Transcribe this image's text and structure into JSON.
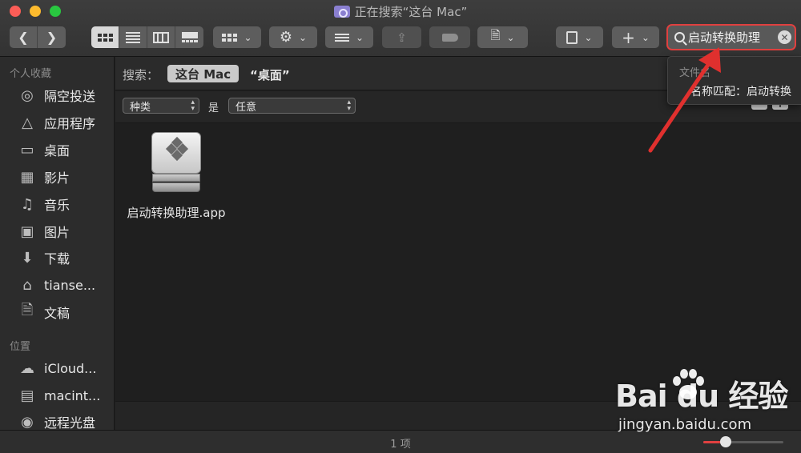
{
  "window": {
    "title": "正在搜索“这台 Mac”"
  },
  "toolbar": {
    "view_modes": [
      "icon-view",
      "list-view",
      "column-view",
      "gallery-view"
    ],
    "active_view": "icon-view"
  },
  "search": {
    "value": "启动转换助理"
  },
  "suggestion": {
    "header": "文件名",
    "item": "名称匹配：启动转换"
  },
  "sidebar": {
    "sections": [
      {
        "title": "个人收藏",
        "items": [
          {
            "label": "隔空投送",
            "icon": "airdrop-icon"
          },
          {
            "label": "应用程序",
            "icon": "applications-icon"
          },
          {
            "label": "桌面",
            "icon": "desktop-icon"
          },
          {
            "label": "影片",
            "icon": "movies-icon"
          },
          {
            "label": "音乐",
            "icon": "music-icon"
          },
          {
            "label": "图片",
            "icon": "pictures-icon"
          },
          {
            "label": "下载",
            "icon": "downloads-icon"
          },
          {
            "label": "tianse...",
            "icon": "home-icon"
          },
          {
            "label": "文稿",
            "icon": "documents-icon"
          }
        ]
      },
      {
        "title": "位置",
        "items": [
          {
            "label": "iCloud...",
            "icon": "icloud-icon"
          },
          {
            "label": "macint...",
            "icon": "disk-icon"
          },
          {
            "label": "远程光盘",
            "icon": "remote-disc-icon"
          }
        ]
      }
    ]
  },
  "scope": {
    "label": "搜索：",
    "this_mac": "这台 Mac",
    "desktop": "“桌面”"
  },
  "criteria": {
    "kind": "种类",
    "is": "是",
    "value": "任意"
  },
  "files": [
    {
      "name": "启动转换助理.app",
      "icon": "boot-camp-assistant-icon"
    }
  ],
  "status": {
    "count": "1 项",
    "zoom_level": 0.28
  },
  "watermark": {
    "brand": "Bai du 经验",
    "url": "jingyan.baidu.com"
  },
  "colors": {
    "accent": "#e0403f"
  }
}
